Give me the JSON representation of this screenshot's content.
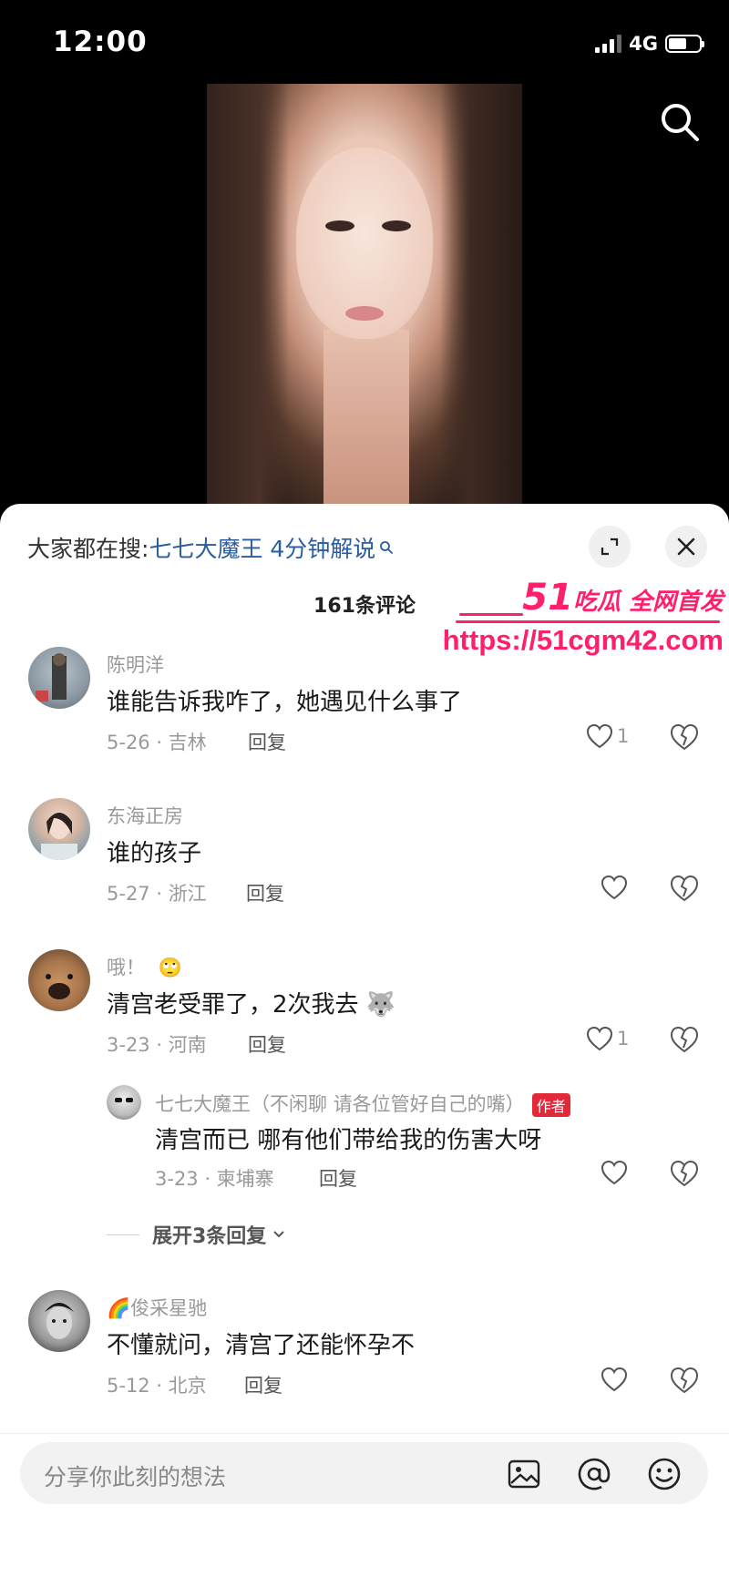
{
  "status": {
    "time": "12:00",
    "network": "4G"
  },
  "sheet": {
    "search_prefix": "大家都在搜:",
    "search_term": "七七大魔王 4分钟解说",
    "comment_count": "161条评论"
  },
  "watermark": {
    "line1_num": "51",
    "line1_text": "吃瓜 全网首发",
    "line2": "https://51cgm42.com"
  },
  "comments": [
    {
      "name": "陈明洋",
      "text": "谁能告诉我咋了，她遇见什么事了",
      "meta": "5-26 · 吉林",
      "reply": "回复",
      "likes": "1"
    },
    {
      "name": "东海正房",
      "text": "谁的孩子",
      "meta": "5-27 · 浙江",
      "reply": "回复",
      "likes": ""
    },
    {
      "name": "哦！",
      "name_emoji": "🙄",
      "text": "清宫老受罪了，2次我去",
      "text_emoji": "🐺",
      "meta": "3-23 · 河南",
      "reply": "回复",
      "likes": "1"
    },
    {
      "name": "俊采星驰",
      "name_emoji": "🌈",
      "text": "不懂就问，清宫了还能怀孕不",
      "meta": "5-12 · 北京",
      "reply": "回复",
      "likes": ""
    }
  ],
  "sub_reply": {
    "name": "七七大魔王（不闲聊 请各位管好自己的嘴）",
    "badge": "作者",
    "text": "清宫而已 哪有他们带给我的伤害大呀",
    "meta": "3-23 · 柬埔寨",
    "reply": "回复"
  },
  "expand_replies": "展开3条回复",
  "input": {
    "placeholder": "分享你此刻的想法"
  },
  "icons": {
    "top_search": "search-icon",
    "expand": "expand-icon",
    "close": "close-icon",
    "like": "heart-icon",
    "dislike": "broken-heart-icon",
    "image": "image-icon",
    "mention": "at-icon",
    "emoji": "smiley-icon"
  },
  "colors": {
    "accent_blue": "#2a5d9f",
    "author_badge": "#e2293a",
    "watermark": "#ff1f6b"
  }
}
